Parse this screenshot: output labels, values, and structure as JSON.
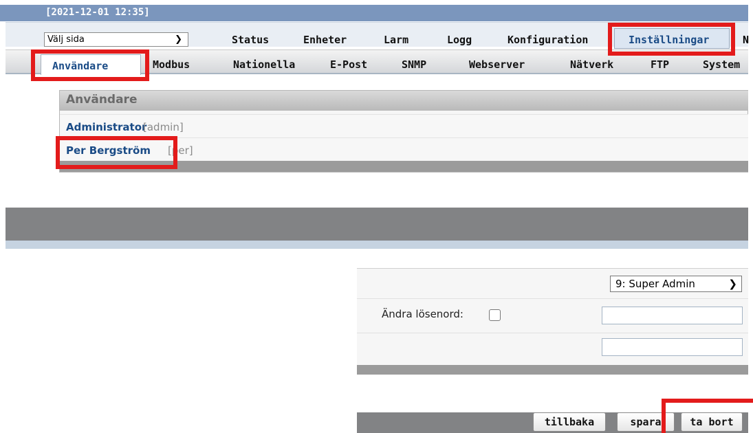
{
  "header": {
    "timestamp": "[2021-12-01 12:35]"
  },
  "main_nav": {
    "page_select": "Välj sida",
    "tabs": [
      "Status",
      "Enheter",
      "Larm",
      "Logg",
      "Konfiguration",
      "Inställningar",
      "N"
    ],
    "active_tab": "Inställningar"
  },
  "sub_nav": {
    "tabs": [
      "Användare",
      "Modbus",
      "Nationella",
      "E-Post",
      "SNMP",
      "Webserver",
      "Nätverk",
      "FTP",
      "System"
    ],
    "active_tab": "Användare"
  },
  "users_panel": {
    "title": "Användare",
    "users": [
      {
        "name": "Administrator",
        "login": "[admin]"
      },
      {
        "name": "Per Bergström",
        "login": "[per]"
      }
    ]
  },
  "user_form": {
    "role_select": "9: Super Admin",
    "change_password_label": "Ändra lösenord:",
    "change_password_checked": false,
    "password_1": "",
    "password_2": ""
  },
  "buttons": {
    "back": "tillbaka",
    "save": "spara",
    "delete": "ta bort"
  },
  "colors": {
    "highlight": "#e31b1b",
    "header_bar": "#7b96bd",
    "link_blue": "#1a4b86"
  }
}
